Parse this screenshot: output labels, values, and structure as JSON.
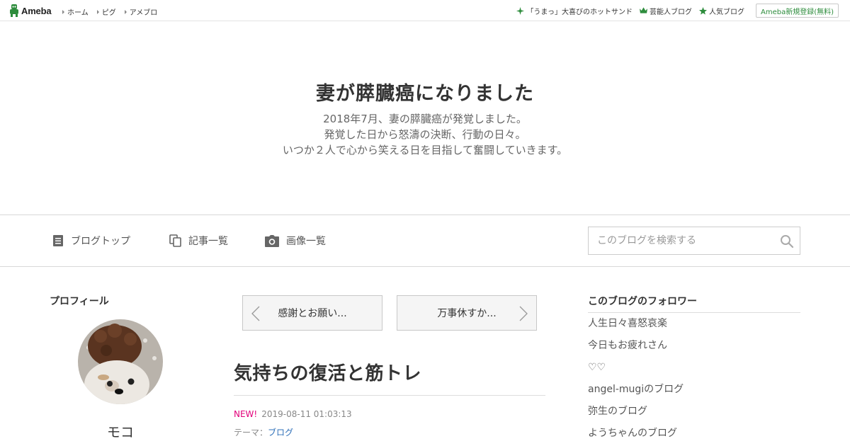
{
  "topbar": {
    "logo_text": "Ameba",
    "nav": [
      "ホーム",
      "ピグ",
      "アメブロ"
    ],
    "links": [
      {
        "icon": "sparkle-icon",
        "label": "「うまっ」大喜びのホットサンド"
      },
      {
        "icon": "crown-icon",
        "label": "芸能人ブログ"
      },
      {
        "icon": "star-icon",
        "label": "人気ブログ"
      }
    ],
    "signup_label": "Ameba新規登録(無料)",
    "accent_color": "#2d8c3c"
  },
  "header": {
    "title": "妻が膵臓癌になりました",
    "description": [
      "2018年7月、妻の膵臓癌が発覚しました。",
      "発覚した日から怒濤の決断、行動の日々。",
      "いつか２人で心から笑える日を目指して奮闘していきます。"
    ]
  },
  "nav": {
    "items": [
      {
        "icon": "document-icon",
        "label": "ブログトップ"
      },
      {
        "icon": "copy-icon",
        "label": "記事一覧"
      },
      {
        "icon": "camera-icon",
        "label": "画像一覧"
      }
    ],
    "search_placeholder": "このブログを検索する"
  },
  "profile": {
    "heading": "プロフィール",
    "name": "モコ"
  },
  "pager": {
    "prev_label": "感謝とお願い...",
    "next_label": "万事休すか..."
  },
  "entry": {
    "title": "気持ちの復活と筋トレ",
    "new_label": "NEW!",
    "date": "2019-08-11 01:03:13",
    "theme_prefix": "テーマ：",
    "theme": "ブログ",
    "new_color": "#e2007a"
  },
  "followers": {
    "heading": "このブログのフォロワー",
    "items": [
      "人生日々喜怒哀楽",
      "今日もお疲れさん",
      "♡♡",
      "angel-mugiのブログ",
      "弥生のブログ",
      "ようちゃんのブログ"
    ]
  }
}
